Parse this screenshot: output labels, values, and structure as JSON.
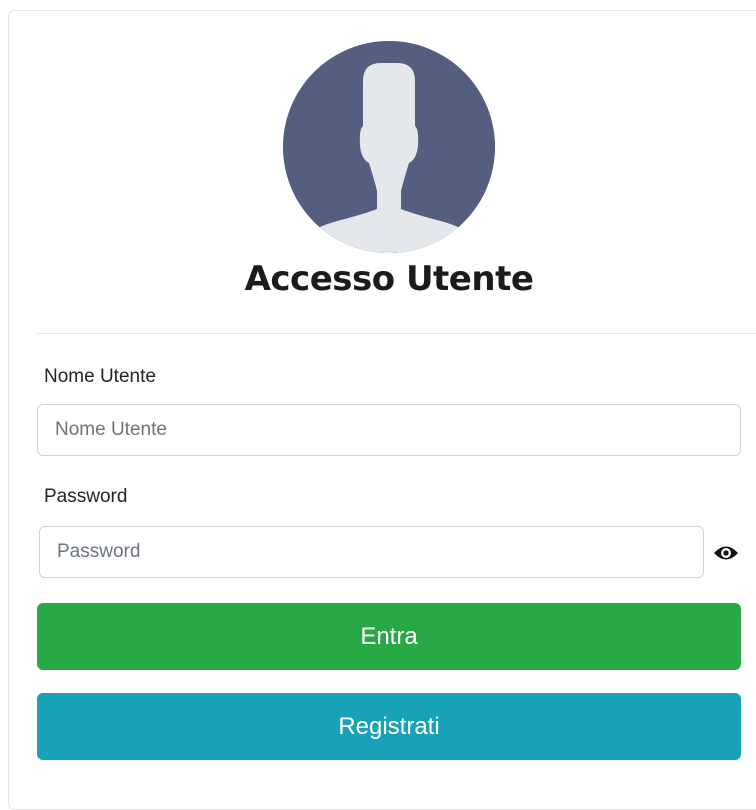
{
  "login": {
    "title": "Accesso Utente",
    "username_label": "Nome Utente",
    "username_placeholder": "Nome Utente",
    "username_value": "",
    "password_label": "Password",
    "password_placeholder": "Password",
    "password_value": "",
    "show_password_icon": "eye-icon",
    "login_button": "Entra",
    "register_button": "Registrati",
    "avatar_icon": "user-avatar-icon"
  },
  "colors": {
    "avatar_bg": "#545f7f",
    "avatar_fg": "#e4e8ea",
    "login_button": "#29a846",
    "register_button": "#17a2b8"
  }
}
